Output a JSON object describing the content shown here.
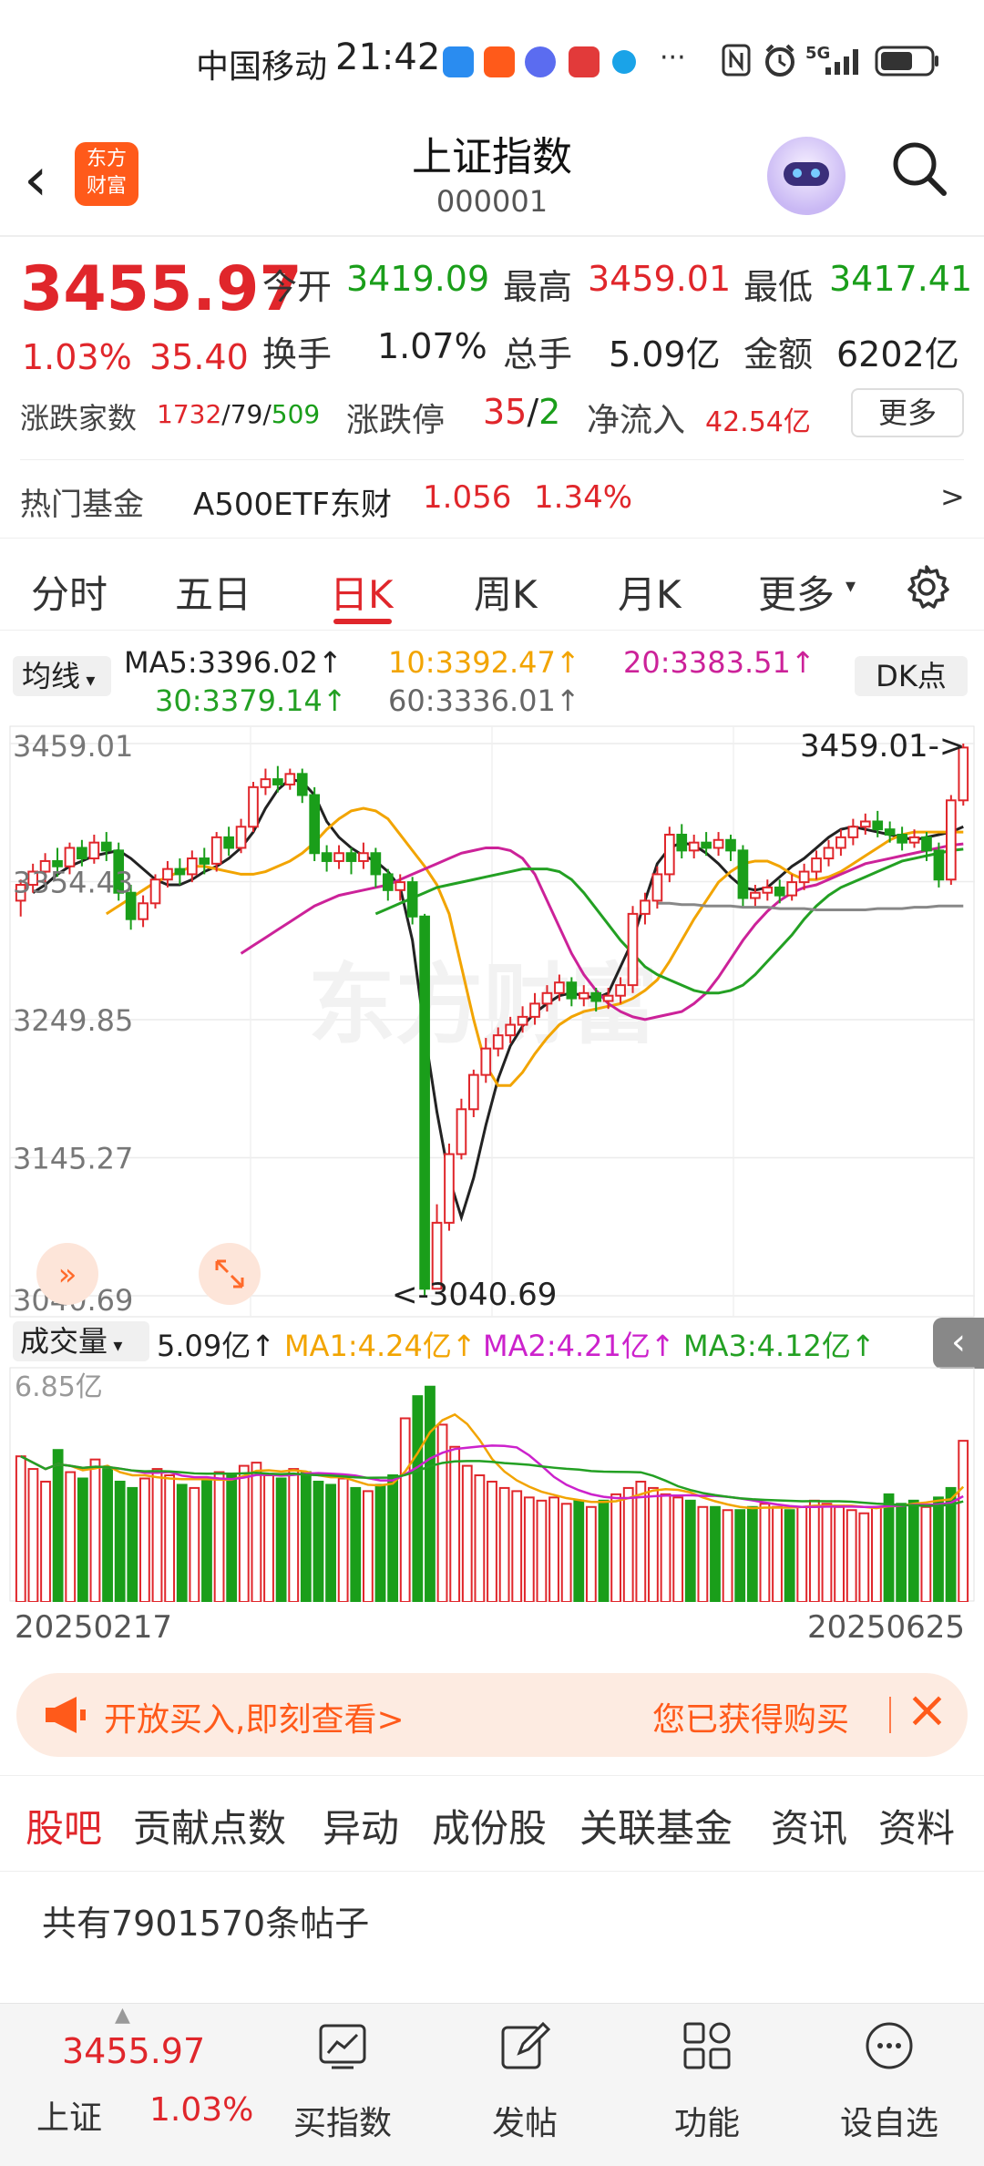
{
  "status_bar": {
    "carrier": "中国移动",
    "time": "21:42",
    "more": "···",
    "network": "5G"
  },
  "header": {
    "logo_text_1": "东方",
    "logo_text_2": "财富",
    "title": "上证指数",
    "code": "000001"
  },
  "quote": {
    "price": "3455.97",
    "change_pct": "1.03%",
    "change": "35.40",
    "open_label": "今开",
    "open": "3419.09",
    "high_label": "最高",
    "high": "3459.01",
    "low_label": "最低",
    "low": "3417.41",
    "turnover_label": "换手",
    "turnover": "1.07%",
    "volume_label": "总手",
    "volume": "5.09亿",
    "amount_label": "金额",
    "amount": "6202亿",
    "breadth_label": "涨跌家数",
    "breadth_up": "1732",
    "sep1": "/",
    "breadth_flat": "79",
    "sep2": "/",
    "breadth_down": "509",
    "limit_label": "涨跌停",
    "limit_up": "35",
    "limit_sep": "/",
    "limit_down": "2",
    "inflow_label": "净流入",
    "inflow": "42.54亿",
    "more_button": "更多"
  },
  "hot_fund": {
    "label": "热门基金",
    "name": "A500ETF东财",
    "price": "1.056",
    "change": "1.34%",
    "arrow": ">"
  },
  "chart_tabs": [
    "分时",
    "五日",
    "日K",
    "周K",
    "月K",
    "更多"
  ],
  "chart_tab_active": "日K",
  "ma_bar": {
    "selector": "均线",
    "ma5": "MA5:3396.02↑",
    "ma10": "10:3392.47↑",
    "ma20": "20:3383.51↑",
    "ma30": "30:3379.14↑",
    "ma60": "60:3336.01↑",
    "dk_button": "DK点",
    "colors": {
      "ma5": "#222222",
      "ma10": "#f2a400",
      "ma20": "#cc2299",
      "ma30": "#23a023",
      "ma60": "#888888"
    }
  },
  "chart_data": {
    "type": "candlestick",
    "y_ticks": [
      "3459.01",
      "3354.43",
      "3249.85",
      "3145.27",
      "3040.69"
    ],
    "ylim": [
      3040.69,
      3459.01
    ],
    "high_marker": "3459.01->",
    "low_marker": "<-3040.69",
    "watermark": "东方财富",
    "x_start": "20250217",
    "x_end": "20250625",
    "candles": [
      [
        3340,
        3352,
        3328,
        3356
      ],
      [
        3352,
        3362,
        3346,
        3368
      ],
      [
        3362,
        3370,
        3354,
        3376
      ],
      [
        3370,
        3366,
        3358,
        3380
      ],
      [
        3366,
        3380,
        3360,
        3384
      ],
      [
        3380,
        3372,
        3366,
        3386
      ],
      [
        3372,
        3384,
        3368,
        3390
      ],
      [
        3384,
        3378,
        3370,
        3392
      ],
      [
        3378,
        3346,
        3340,
        3384
      ],
      [
        3346,
        3326,
        3318,
        3352
      ],
      [
        3326,
        3338,
        3320,
        3344
      ],
      [
        3338,
        3356,
        3334,
        3360
      ],
      [
        3356,
        3364,
        3350,
        3370
      ],
      [
        3364,
        3360,
        3352,
        3372
      ],
      [
        3360,
        3372,
        3354,
        3378
      ],
      [
        3372,
        3368,
        3360,
        3380
      ],
      [
        3368,
        3388,
        3362,
        3392
      ],
      [
        3388,
        3380,
        3374,
        3396
      ],
      [
        3380,
        3396,
        3376,
        3402
      ],
      [
        3396,
        3426,
        3392,
        3430
      ],
      [
        3426,
        3432,
        3420,
        3440
      ],
      [
        3432,
        3428,
        3422,
        3442
      ],
      [
        3428,
        3436,
        3424,
        3440
      ],
      [
        3436,
        3420,
        3414,
        3440
      ],
      [
        3420,
        3376,
        3370,
        3426
      ],
      [
        3376,
        3370,
        3362,
        3382
      ],
      [
        3370,
        3376,
        3364,
        3382
      ],
      [
        3376,
        3370,
        3360,
        3380
      ],
      [
        3370,
        3376,
        3364,
        3384
      ],
      [
        3376,
        3360,
        3350,
        3380
      ],
      [
        3360,
        3348,
        3340,
        3364
      ],
      [
        3348,
        3354,
        3340,
        3360
      ],
      [
        3354,
        3328,
        3322,
        3358
      ],
      [
        3328,
        3046,
        3040,
        3330
      ],
      [
        3046,
        3096,
        3070,
        3110
      ],
      [
        3096,
        3148,
        3090,
        3156
      ],
      [
        3148,
        3182,
        3144,
        3190
      ],
      [
        3182,
        3208,
        3176,
        3212
      ],
      [
        3208,
        3228,
        3202,
        3236
      ],
      [
        3228,
        3238,
        3222,
        3244
      ],
      [
        3238,
        3246,
        3232,
        3252
      ],
      [
        3246,
        3252,
        3240,
        3260
      ],
      [
        3252,
        3262,
        3246,
        3270
      ],
      [
        3262,
        3270,
        3256,
        3276
      ],
      [
        3270,
        3278,
        3264,
        3284
      ],
      [
        3278,
        3266,
        3260,
        3282
      ],
      [
        3266,
        3270,
        3260,
        3276
      ],
      [
        3270,
        3264,
        3256,
        3274
      ],
      [
        3264,
        3268,
        3258,
        3274
      ],
      [
        3268,
        3276,
        3262,
        3282
      ],
      [
        3276,
        3330,
        3270,
        3336
      ],
      [
        3330,
        3340,
        3322,
        3346
      ],
      [
        3340,
        3360,
        3334,
        3366
      ],
      [
        3360,
        3390,
        3354,
        3396
      ],
      [
        3390,
        3378,
        3372,
        3398
      ],
      [
        3378,
        3384,
        3372,
        3390
      ],
      [
        3384,
        3380,
        3374,
        3392
      ],
      [
        3380,
        3386,
        3374,
        3392
      ],
      [
        3386,
        3378,
        3370,
        3390
      ],
      [
        3378,
        3342,
        3336,
        3382
      ],
      [
        3342,
        3346,
        3336,
        3352
      ],
      [
        3346,
        3350,
        3340,
        3356
      ],
      [
        3350,
        3344,
        3338,
        3356
      ],
      [
        3344,
        3354,
        3340,
        3360
      ],
      [
        3354,
        3362,
        3348,
        3368
      ],
      [
        3362,
        3372,
        3356,
        3378
      ],
      [
        3372,
        3380,
        3366,
        3386
      ],
      [
        3380,
        3388,
        3374,
        3394
      ],
      [
        3388,
        3396,
        3382,
        3402
      ],
      [
        3396,
        3400,
        3390,
        3406
      ],
      [
        3400,
        3394,
        3388,
        3408
      ],
      [
        3394,
        3390,
        3384,
        3400
      ],
      [
        3390,
        3384,
        3378,
        3396
      ],
      [
        3384,
        3388,
        3380,
        3394
      ],
      [
        3388,
        3378,
        3370,
        3392
      ],
      [
        3378,
        3356,
        3350,
        3384
      ],
      [
        3356,
        3416,
        3352,
        3420
      ],
      [
        3416,
        3456,
        3412,
        3459
      ]
    ],
    "ma_lines": {
      "ma5": [
        3346,
        3352,
        3360,
        3366,
        3370,
        3374,
        3376,
        3378,
        3372,
        3364,
        3356,
        3352,
        3352,
        3356,
        3362,
        3366,
        3372,
        3380,
        3392,
        3410,
        3424,
        3432,
        3430,
        3420,
        3400,
        3388,
        3380,
        3374,
        3370,
        3362,
        3350,
        3310,
        3240,
        3180,
        3130,
        3100,
        3130,
        3170,
        3205,
        3230,
        3245,
        3255,
        3262,
        3268,
        3270,
        3268,
        3266,
        3270,
        3290,
        3310,
        3340,
        3368,
        3380,
        3384,
        3382,
        3376,
        3368,
        3358,
        3350,
        3348,
        3350,
        3358,
        3366,
        3372,
        3380,
        3388,
        3394,
        3396,
        3394,
        3392,
        3390,
        3388,
        3386,
        3388,
        3390,
        3392,
        3396
      ],
      "ma10": [
        3330,
        3336,
        3342,
        3348,
        3354,
        3358,
        3362,
        3366,
        3366,
        3364,
        3362,
        3360,
        3360,
        3362,
        3366,
        3370,
        3376,
        3384,
        3394,
        3402,
        3408,
        3410,
        3408,
        3402,
        3390,
        3378,
        3366,
        3352,
        3330,
        3290,
        3250,
        3215,
        3200,
        3200,
        3210,
        3224,
        3236,
        3246,
        3252,
        3256,
        3258,
        3260,
        3262,
        3266,
        3272,
        3280,
        3294,
        3310,
        3326,
        3340,
        3354,
        3362,
        3368,
        3370,
        3370,
        3366,
        3360,
        3356,
        3356,
        3358,
        3362,
        3368,
        3374,
        3380,
        3386,
        3390,
        3392,
        3392,
        3392,
        3392,
        3392
      ],
      "ma20": [
        3300,
        3306,
        3312,
        3318,
        3324,
        3330,
        3336,
        3340,
        3344,
        3346,
        3348,
        3350,
        3352,
        3356,
        3360,
        3364,
        3368,
        3372,
        3376,
        3378,
        3380,
        3380,
        3378,
        3372,
        3360,
        3340,
        3320,
        3300,
        3284,
        3272,
        3262,
        3256,
        3252,
        3250,
        3252,
        3254,
        3256,
        3262,
        3270,
        3282,
        3296,
        3310,
        3322,
        3332,
        3340,
        3346,
        3350,
        3352,
        3356,
        3360,
        3364,
        3368,
        3370,
        3372,
        3374,
        3376,
        3378,
        3380,
        3382,
        3383
      ],
      "ma30": [
        3330,
        3334,
        3338,
        3342,
        3346,
        3350,
        3352,
        3354,
        3356,
        3358,
        3360,
        3362,
        3364,
        3364,
        3364,
        3362,
        3356,
        3346,
        3334,
        3322,
        3310,
        3300,
        3290,
        3284,
        3280,
        3276,
        3272,
        3270,
        3270,
        3272,
        3276,
        3284,
        3294,
        3304,
        3314,
        3326,
        3336,
        3344,
        3350,
        3354,
        3358,
        3362,
        3366,
        3370,
        3372,
        3374,
        3376,
        3378,
        3379
      ],
      "ma60": [
        3338,
        3338,
        3337,
        3337,
        3336,
        3336,
        3336,
        3335,
        3335,
        3335,
        3334,
        3334,
        3334,
        3333,
        3333,
        3333,
        3333,
        3333,
        3334,
        3334,
        3334,
        3335,
        3335,
        3336,
        3336,
        3336
      ]
    },
    "volume": {
      "selector": "成交量",
      "current": "5.09亿↑",
      "ma1": "MA1:4.24亿↑",
      "ma2": "MA2:4.21亿↑",
      "ma3": "MA3:4.12亿↑",
      "max_label": "6.85亿",
      "ylim": [
        0,
        6.85
      ],
      "values": [
        4.6,
        4.2,
        3.8,
        4.8,
        4.1,
        3.9,
        4.5,
        4.2,
        3.8,
        3.6,
        3.9,
        4.2,
        4.0,
        3.7,
        3.6,
        3.9,
        4.1,
        4.0,
        4.3,
        4.4,
        4.0,
        3.9,
        4.2,
        4.1,
        3.8,
        3.7,
        3.9,
        3.6,
        3.5,
        3.7,
        4.0,
        5.8,
        6.5,
        6.8,
        5.6,
        4.9,
        4.3,
        4.0,
        3.8,
        3.6,
        3.5,
        3.3,
        3.2,
        3.3,
        3.1,
        3.2,
        3.0,
        3.2,
        3.4,
        3.6,
        3.8,
        3.6,
        3.4,
        3.3,
        3.2,
        3.0,
        3.0,
        2.9,
        2.9,
        3.0,
        3.1,
        3.0,
        2.9,
        3.0,
        3.2,
        3.1,
        3.0,
        2.9,
        2.8,
        3.0,
        3.4,
        3.1,
        3.2,
        3.0,
        3.3,
        3.6,
        5.09
      ]
    }
  },
  "banner": {
    "left_text": "开放买入,即刻查看>",
    "right_text": "您已获得购买",
    "close": "×"
  },
  "bottom_tabs": [
    "股吧",
    "贡献点数",
    "异动",
    "成份股",
    "关联基金",
    "资讯",
    "资料"
  ],
  "bottom_tab_active": "股吧",
  "posts": "共有7901570条帖子",
  "bottom_bar": {
    "index_price": "3455.97",
    "index_name": "上证",
    "index_change": "1.03%",
    "items": [
      "买指数",
      "发帖",
      "功能",
      "设自选"
    ]
  }
}
